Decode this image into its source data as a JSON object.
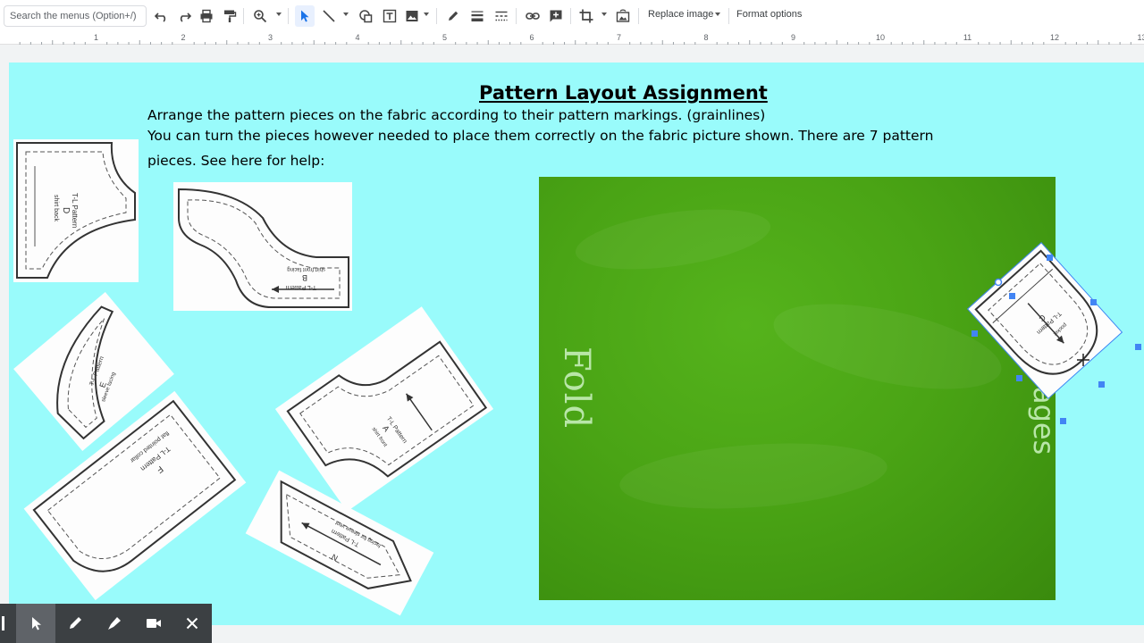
{
  "toolbar": {
    "search_placeholder": "Search the menus (Option+/)",
    "replace_image_label": "Replace image",
    "format_options_label": "Format options"
  },
  "ruler": {
    "marks": [
      "1",
      "2",
      "3",
      "4",
      "5",
      "6",
      "7",
      "8",
      "9",
      "10",
      "11",
      "12",
      "13"
    ]
  },
  "slide": {
    "title": "Pattern Layout Assignment",
    "instruction_line1": "Arrange the pattern pieces on the fabric according to their pattern markings. (grainlines)",
    "instruction_line2": "You can turn the pieces however needed to place them correctly on the fabric picture shown. There are 7 pattern",
    "instruction_line3": "pieces. See here for help:",
    "fabric_fold_label": "Fold",
    "fabric_edge_label": "ages"
  },
  "pieces": {
    "d": {
      "line1": "T-L Pattern",
      "letter": "D",
      "line3": "shirt back"
    },
    "b": {
      "line1": "T-L Pattern",
      "letter": "B",
      "line3": "shirt front facing"
    },
    "e": {
      "line1": "T-L Pattern",
      "letter": "E",
      "line3": "sleeve facing"
    },
    "a": {
      "line1": "T-L Pattern",
      "letter": "A",
      "line3": "shirt front"
    },
    "f": {
      "line1": "T-L Pattern",
      "letter": "F",
      "line3": "flat pointed collar"
    },
    "n": {
      "line1": "T-L Pattern",
      "letter": "N",
      "line3": "facing for sleeve vent"
    },
    "c": {
      "line1": "T-L Pattern",
      "letter": "C",
      "line3": "pocket"
    }
  },
  "colors": {
    "slide_bg": "#99fbfb",
    "fabric": "#4aa415",
    "selection": "#4285f4"
  }
}
